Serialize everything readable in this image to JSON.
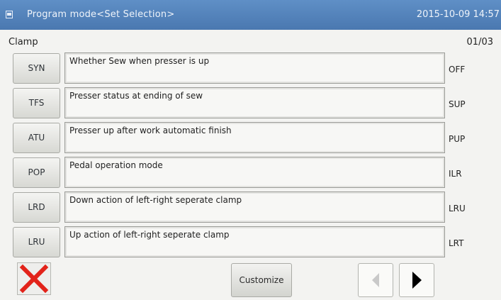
{
  "header": {
    "title": "Program mode<Set Selection>",
    "datetime": "2015-10-09 14:57"
  },
  "section": {
    "label": "Clamp",
    "page": "01/03"
  },
  "rows": [
    {
      "code": "SYN",
      "description": "Whether Sew when presser is up",
      "value": "OFF"
    },
    {
      "code": "TFS",
      "description": "Presser status at ending of sew",
      "value": "SUP"
    },
    {
      "code": "ATU",
      "description": "Presser up after work automatic finish",
      "value": "PUP"
    },
    {
      "code": "POP",
      "description": "Pedal operation mode",
      "value": "ILR"
    },
    {
      "code": "LRD",
      "description": "Down action of left-right seperate clamp",
      "value": "LRU"
    },
    {
      "code": "LRU",
      "description": "Up action of left-right seperate clamp",
      "value": "LRT"
    }
  ],
  "footer": {
    "customize_label": "Customize",
    "cancel_icon": "red-x-icon",
    "prev_icon": "arrow-left-icon",
    "next_icon": "arrow-right-icon"
  },
  "colors": {
    "titlebar": "#4f7fb8",
    "cancel_red": "#e2231a",
    "prev_disabled": "#c9c9c9",
    "next_active": "#000000"
  }
}
